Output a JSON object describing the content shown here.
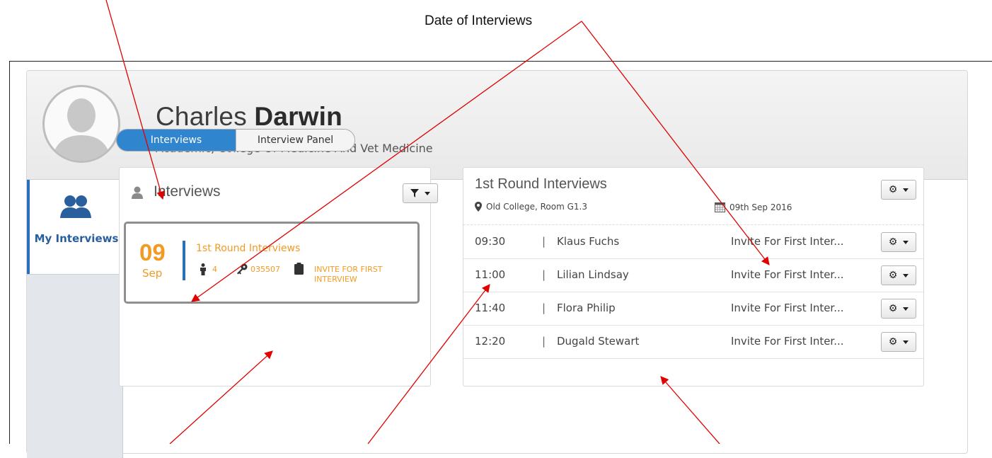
{
  "annotation": {
    "title": "Date of Interviews"
  },
  "profile": {
    "first_name": "Charles",
    "last_name": "Darwin",
    "title": "Academic, College Of Medicine And Vet Medicine"
  },
  "sidebar": {
    "items": [
      {
        "label": "My Interviews",
        "icon": "users-icon",
        "active": true
      }
    ]
  },
  "tabs": [
    {
      "label": "Interviews",
      "active": true
    },
    {
      "label": "Interview Panel",
      "active": false
    }
  ],
  "left_panel": {
    "title": "Interviews",
    "icon": "user-icon",
    "filter_icon": "filter-icon",
    "card": {
      "day": "09",
      "month": "Sep",
      "title": "1st Round Interviews",
      "candidates": "4",
      "code": "035507",
      "status": "INVITE FOR FIRST INTERVIEW"
    }
  },
  "right_panel": {
    "title": "1st Round Interviews",
    "location": "Old College, Room G1.3",
    "date": "09th Sep 2016",
    "rows": [
      {
        "time": "09:30",
        "name": "Klaus Fuchs",
        "status": "Invite For First Inter..."
      },
      {
        "time": "11:00",
        "name": "Lilian Lindsay",
        "status": "Invite For First Inter..."
      },
      {
        "time": "11:40",
        "name": "Flora Philip",
        "status": "Invite For First Inter..."
      },
      {
        "time": "12:20",
        "name": "Dugald Stewart",
        "status": "Invite For First Inter..."
      }
    ]
  },
  "colors": {
    "accent": "#2f86cf",
    "nav_text": "#2a5f9e",
    "highlight": "#f39a22",
    "annotation_arrow": "#e00000"
  }
}
